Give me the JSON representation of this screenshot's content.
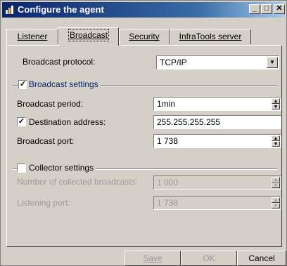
{
  "window": {
    "title": "Configure the agent"
  },
  "tabs": [
    {
      "label": "Listener",
      "active": false
    },
    {
      "label": "Broadcast",
      "active": true
    },
    {
      "label": "Security",
      "active": false
    },
    {
      "label": "InfraTools server",
      "active": false
    }
  ],
  "broadcast_protocol": {
    "label": "Broadcast protocol:",
    "value": "TCP/IP"
  },
  "broadcast_settings": {
    "title": "Broadcast settings",
    "checked": true,
    "period": {
      "label": "Broadcast period:",
      "value": "1min"
    },
    "destination": {
      "label": "Destination address:",
      "checked": true,
      "value": "255.255.255.255"
    },
    "port": {
      "label": "Broadcast port:",
      "value": "1 738"
    }
  },
  "collector_settings": {
    "title": "Collector settings",
    "checked": false,
    "collected": {
      "label": "Number of collected broadcasts:",
      "value": "1 000"
    },
    "listening_port": {
      "label": "Listening port:",
      "value": "1 738"
    }
  },
  "footer": {
    "save": "Save",
    "ok": "OK",
    "cancel": "Cancel"
  },
  "colors": {
    "titlebar_start": "#0a246a",
    "titlebar_end": "#a6caf0",
    "face": "#d4d0c8",
    "accent": "#0a246a"
  }
}
